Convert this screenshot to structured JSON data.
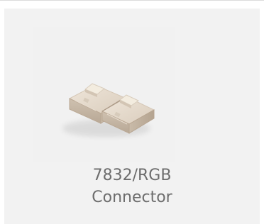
{
  "product": {
    "name_line1": "7832/RGB",
    "name_line2": "Connector",
    "image_icon": "connector-product-image"
  }
}
